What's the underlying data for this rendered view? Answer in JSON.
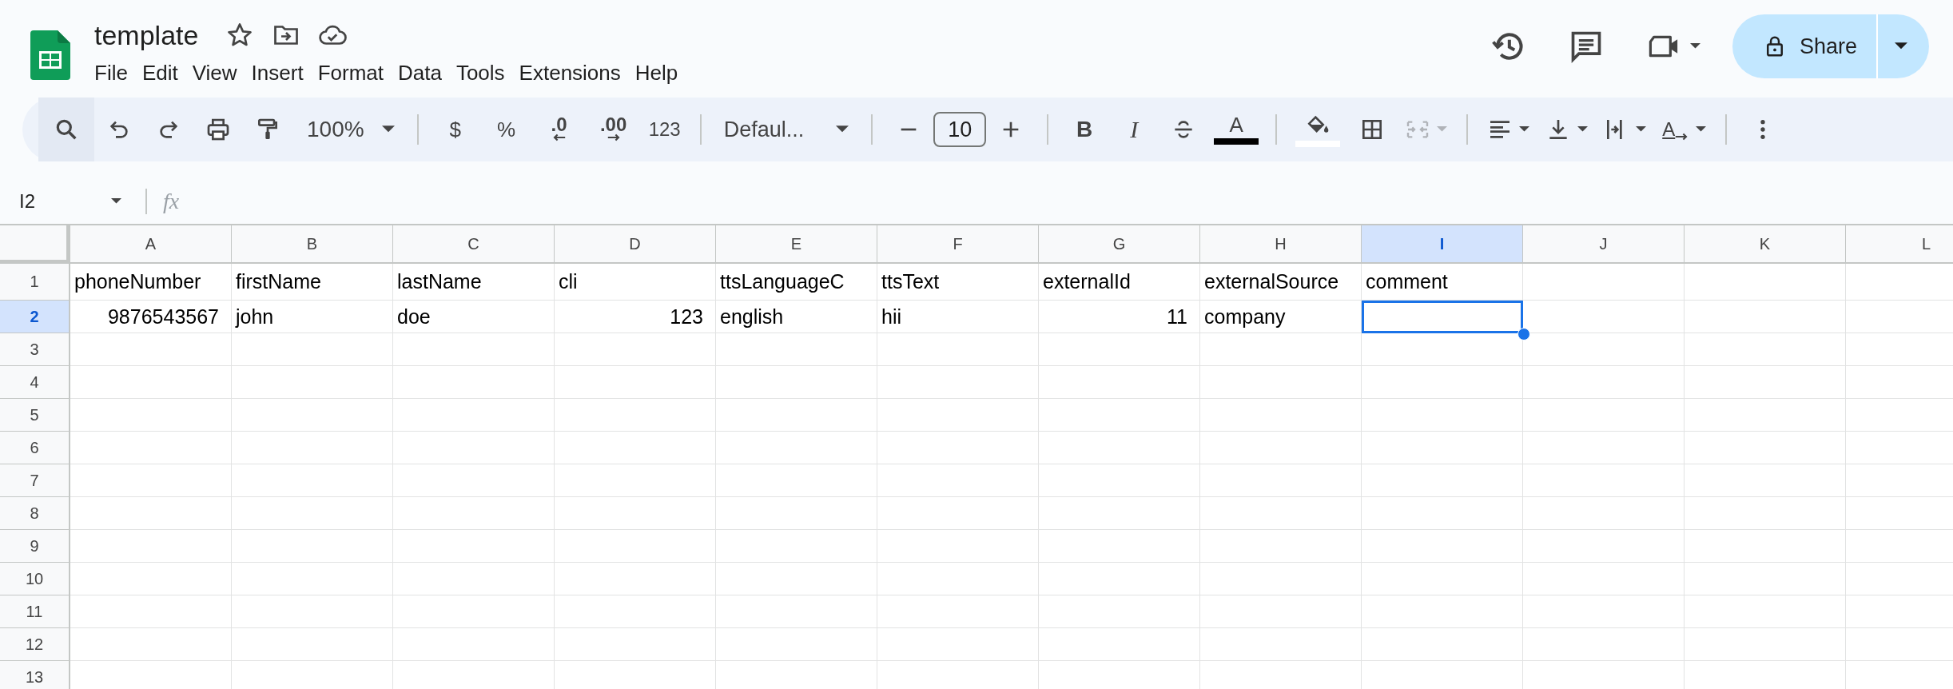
{
  "document": {
    "title": "template"
  },
  "menu": [
    {
      "label": "File"
    },
    {
      "label": "Edit"
    },
    {
      "label": "View"
    },
    {
      "label": "Insert"
    },
    {
      "label": "Format"
    },
    {
      "label": "Data"
    },
    {
      "label": "Tools"
    },
    {
      "label": "Extensions"
    },
    {
      "label": "Help"
    }
  ],
  "share_button": {
    "label": "Share"
  },
  "toolbar": {
    "zoom": "100%",
    "currency": "$",
    "percent": "%",
    "decrease_decimals": ".0",
    "increase_decimals": ".00",
    "number_format": "123",
    "font": "Defaul...",
    "font_size": "10",
    "bold": "B",
    "italic": "I",
    "text_color": "A",
    "rotate": "A"
  },
  "formula_bar": {
    "name_box": "I2",
    "fx": "fx"
  },
  "sheet": {
    "columns": [
      {
        "label": "A",
        "selected": false
      },
      {
        "label": "B",
        "selected": false
      },
      {
        "label": "C",
        "selected": false
      },
      {
        "label": "D",
        "selected": false
      },
      {
        "label": "E",
        "selected": false
      },
      {
        "label": "F",
        "selected": false
      },
      {
        "label": "G",
        "selected": false
      },
      {
        "label": "H",
        "selected": false
      },
      {
        "label": "I",
        "selected": true
      },
      {
        "label": "J",
        "selected": false
      },
      {
        "label": "K",
        "selected": false
      },
      {
        "label": "L",
        "selected": false
      }
    ],
    "rows": [
      {
        "number": "1",
        "selected": false,
        "cells": [
          {
            "value": "phoneNumber",
            "kind": "text",
            "selected": false
          },
          {
            "value": "firstName",
            "kind": "text",
            "selected": false
          },
          {
            "value": "lastName",
            "kind": "text",
            "selected": false
          },
          {
            "value": "cli",
            "kind": "text",
            "selected": false
          },
          {
            "value": "ttsLanguageC",
            "kind": "text",
            "selected": false
          },
          {
            "value": "ttsText",
            "kind": "text",
            "selected": false
          },
          {
            "value": "externalId",
            "kind": "text",
            "selected": false
          },
          {
            "value": "externalSource",
            "kind": "text",
            "selected": false
          },
          {
            "value": "comment",
            "kind": "text",
            "selected": false
          }
        ]
      },
      {
        "number": "2",
        "selected": true,
        "cells": [
          {
            "value": "9876543567",
            "kind": "number",
            "selected": false
          },
          {
            "value": "john",
            "kind": "text",
            "selected": false
          },
          {
            "value": "doe",
            "kind": "text",
            "selected": false
          },
          {
            "value": "123",
            "kind": "number",
            "selected": false
          },
          {
            "value": "english",
            "kind": "text",
            "selected": false
          },
          {
            "value": "hii",
            "kind": "text",
            "selected": false
          },
          {
            "value": "11",
            "kind": "number",
            "selected": false
          },
          {
            "value": "company",
            "kind": "text",
            "selected": false
          },
          {
            "kind": "text",
            "selected": true
          }
        ]
      },
      {
        "number": "3",
        "selected": false
      },
      {
        "number": "4",
        "selected": false
      },
      {
        "number": "5",
        "selected": false
      },
      {
        "number": "6",
        "selected": false
      },
      {
        "number": "7",
        "selected": false
      },
      {
        "number": "8",
        "selected": false
      },
      {
        "number": "9",
        "selected": false
      },
      {
        "number": "10",
        "selected": false
      },
      {
        "number": "11",
        "selected": false
      },
      {
        "number": "12",
        "selected": false
      },
      {
        "number": "13",
        "selected": false
      }
    ]
  }
}
